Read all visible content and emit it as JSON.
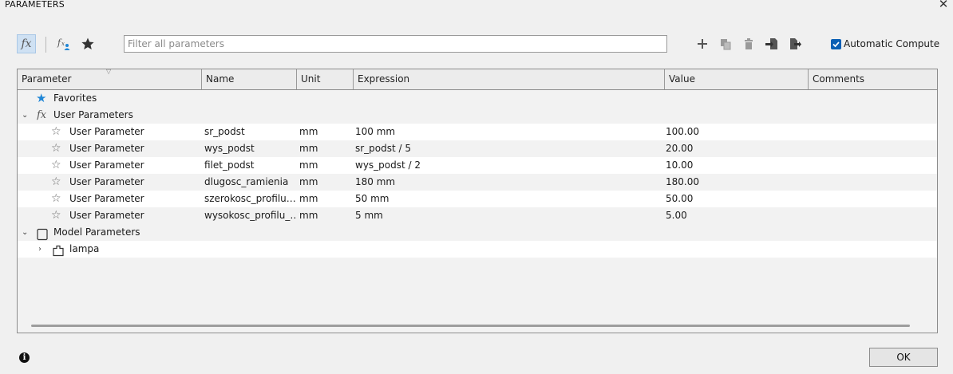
{
  "window": {
    "title": "PARAMETERS",
    "close_glyph": "✕"
  },
  "toolbar": {
    "fx_label": "fx",
    "search_placeholder": "Filter all parameters",
    "auto_compute_label": "Automatic Compute",
    "auto_compute_checked": true
  },
  "table": {
    "columns": [
      "Parameter",
      "Name",
      "Unit",
      "Expression",
      "Value",
      "Comments"
    ],
    "favorites_label": "Favorites",
    "user_group_label": "User Parameters",
    "model_group_label": "Model Parameters",
    "model_child_label": "lampa",
    "user_rows": [
      {
        "param": "User Parameter",
        "name": "sr_podst",
        "unit": "mm",
        "expression": "100 mm",
        "value": "100.00"
      },
      {
        "param": "User Parameter",
        "name": "wys_podst",
        "unit": "mm",
        "expression": "sr_podst / 5",
        "value": "20.00"
      },
      {
        "param": "User Parameter",
        "name": "filet_podst",
        "unit": "mm",
        "expression": "wys_podst / 2",
        "value": "10.00"
      },
      {
        "param": "User Parameter",
        "name": "dlugosc_ramienia",
        "unit": "mm",
        "expression": "180 mm",
        "value": "180.00"
      },
      {
        "param": "User Parameter",
        "name": "szerokosc_profilu…",
        "unit": "mm",
        "expression": "50 mm",
        "value": "50.00"
      },
      {
        "param": "User Parameter",
        "name": "wysokosc_profilu_…",
        "unit": "mm",
        "expression": "5 mm",
        "value": "5.00"
      }
    ]
  },
  "footer": {
    "ok_label": "OK",
    "info_glyph": "i"
  },
  "colors": {
    "accent": "#0a5fb4",
    "favorite_star": "#1f86d6",
    "background": "#f0f0f0"
  },
  "icons": [
    "fx-icon",
    "fx-user-icon",
    "star-icon",
    "add-icon",
    "copy-icon",
    "delete-icon",
    "import-icon",
    "export-icon",
    "info-icon"
  ]
}
